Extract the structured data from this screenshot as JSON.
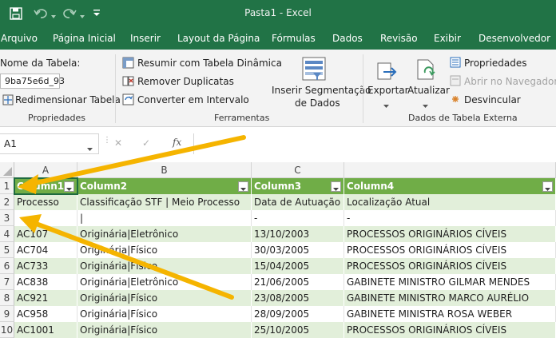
{
  "window": {
    "title": "Pasta1  -  Excel"
  },
  "menu_tabs": [
    "Arquivo",
    "Página Inicial",
    "Inserir",
    "Layout da Página",
    "Fórmulas",
    "Dados",
    "Revisão",
    "Exibir",
    "Desenvolvedor"
  ],
  "ribbon": {
    "propriedades": {
      "table_name_label": "Nome da Tabela:",
      "table_name_value": "9ba75e6d_93",
      "resize_label": "Redimensionar Tabela",
      "group_label": "Propriedades"
    },
    "ferramentas": {
      "summarize_label": "Resumir com Tabela Dinâmica",
      "remove_duplicates_label": "Remover Duplicatas",
      "convert_label": "Converter em Intervalo",
      "slicer_line1": "Inserir Segmentação",
      "slicer_line2": "de Dados",
      "group_label": "Ferramentas"
    },
    "externos": {
      "export_label": "Exportar",
      "refresh_label": "Atualizar",
      "properties_label": "Propriedades",
      "open_browser_label": "Abrir no Navegador",
      "unlink_label": "Desvincular",
      "group_label": "Dados de Tabela Externa"
    }
  },
  "formula_bar": {
    "name_box": "A1",
    "cancel": "✕",
    "enter": "✓",
    "fx": "fx",
    "value": ""
  },
  "grid": {
    "column_letters": [
      "A",
      "B",
      "C"
    ],
    "header_row": [
      "Column1",
      "Column2",
      "Column3",
      "Column4"
    ],
    "row_numbers": [
      "1",
      "2",
      "3",
      "4",
      "5",
      "6",
      "7",
      "8",
      "9",
      "10"
    ],
    "rows": [
      [
        "Processo",
        "Classificação STF | Meio Processo",
        "Data de Autuação",
        "Localização Atual"
      ],
      [
        "",
        "|",
        "-",
        "-"
      ],
      [
        "AC107",
        "Originária|Eletrônico",
        "13/10/2003",
        "PROCESSOS ORIGINÁRIOS CÍVEIS"
      ],
      [
        "AC704",
        "Originária|Físico",
        "30/03/2005",
        "PROCESSOS ORIGINÁRIOS CÍVEIS"
      ],
      [
        "AC733",
        "Originária|Físico",
        "15/04/2005",
        "PROCESSOS ORIGINÁRIOS CÍVEIS"
      ],
      [
        "AC838",
        "Originária|Eletrônico",
        "21/06/2005",
        "GABINETE MINISTRO GILMAR MENDES"
      ],
      [
        "AC921",
        "Originária|Físico",
        "23/08/2005",
        "GABINETE MINISTRO MARCO AURÉLIO"
      ],
      [
        "AC958",
        "Originária|Físico",
        "28/09/2005",
        "GABINETE MINISTRA ROSA WEBER"
      ],
      [
        "AC1001",
        "Originária|Físico",
        "25/10/2005",
        "PROCESSOS ORIGINÁRIOS CÍVEIS"
      ]
    ]
  },
  "colors": {
    "excel_green": "#217346",
    "table_header": "#70ad47",
    "band": "#e2efda",
    "arrow": "#f5b400"
  }
}
